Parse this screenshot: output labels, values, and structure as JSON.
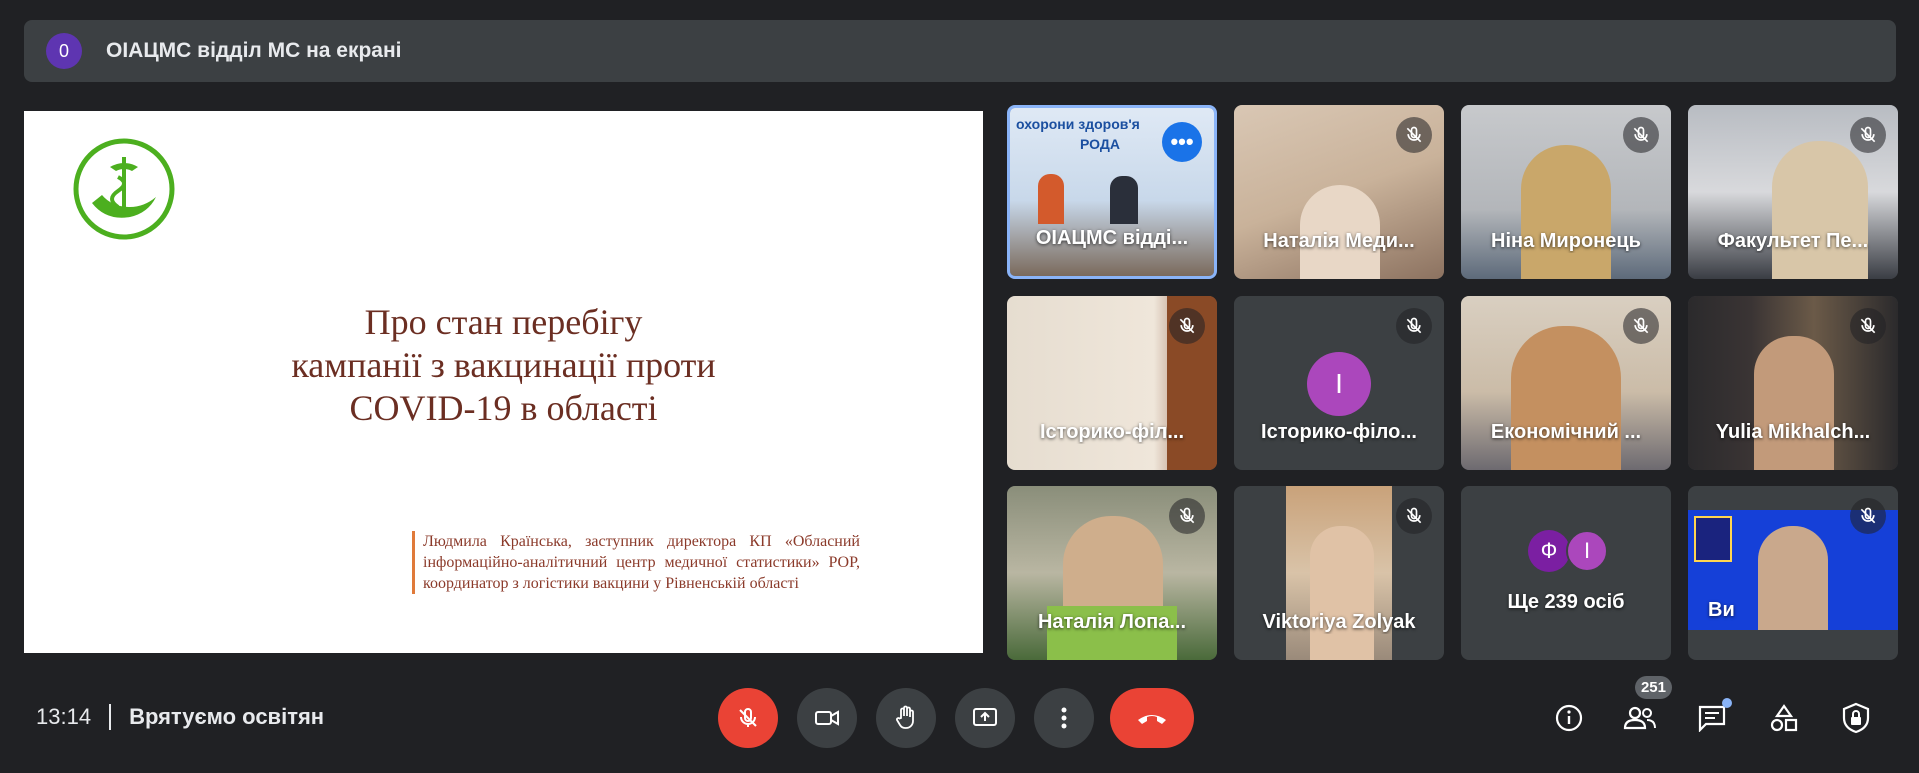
{
  "presenter_bar": {
    "count": "0",
    "title": "ОІАЦМС відділ МС на екрані"
  },
  "slide": {
    "title_lines": [
      "Про стан перебігу",
      "кампанії з вакцинації проти",
      "COVID-19 в області"
    ],
    "author": "Людмила Країнська, заступник директора КП «Обласний інформаційно-аналітичний центр медичної статистики» РОР, координатор з логістики вакцини у Рівненській області"
  },
  "tiles": [
    {
      "name": "ОІАЦМС відді...",
      "banner": "охорони здоров'я",
      "banner2": "РОДА"
    },
    {
      "name": "Наталія Меди..."
    },
    {
      "name": "Ніна Миронець"
    },
    {
      "name": "Факультет Пе..."
    },
    {
      "name": "Історико-філ..."
    },
    {
      "name": "Історико-філо...",
      "initial": "І"
    },
    {
      "name": "Економічний ..."
    },
    {
      "name": "Yulia Mikhalch..."
    },
    {
      "name": "Наталія Лопа..."
    },
    {
      "name": "Viktoriya Zolyak"
    },
    {
      "name": "Ще 239 осіб",
      "initials": [
        "Ф",
        "І"
      ]
    },
    {
      "name": "Ви"
    }
  ],
  "bottom": {
    "time": "13:14",
    "meeting": "Врятуємо освітян"
  },
  "participants_count": "251",
  "colors": {
    "bg": "#202124",
    "tile": "#3c4043",
    "red": "#ea4335",
    "accent": "#8ab4f8",
    "avatar": "#ab47bc"
  }
}
